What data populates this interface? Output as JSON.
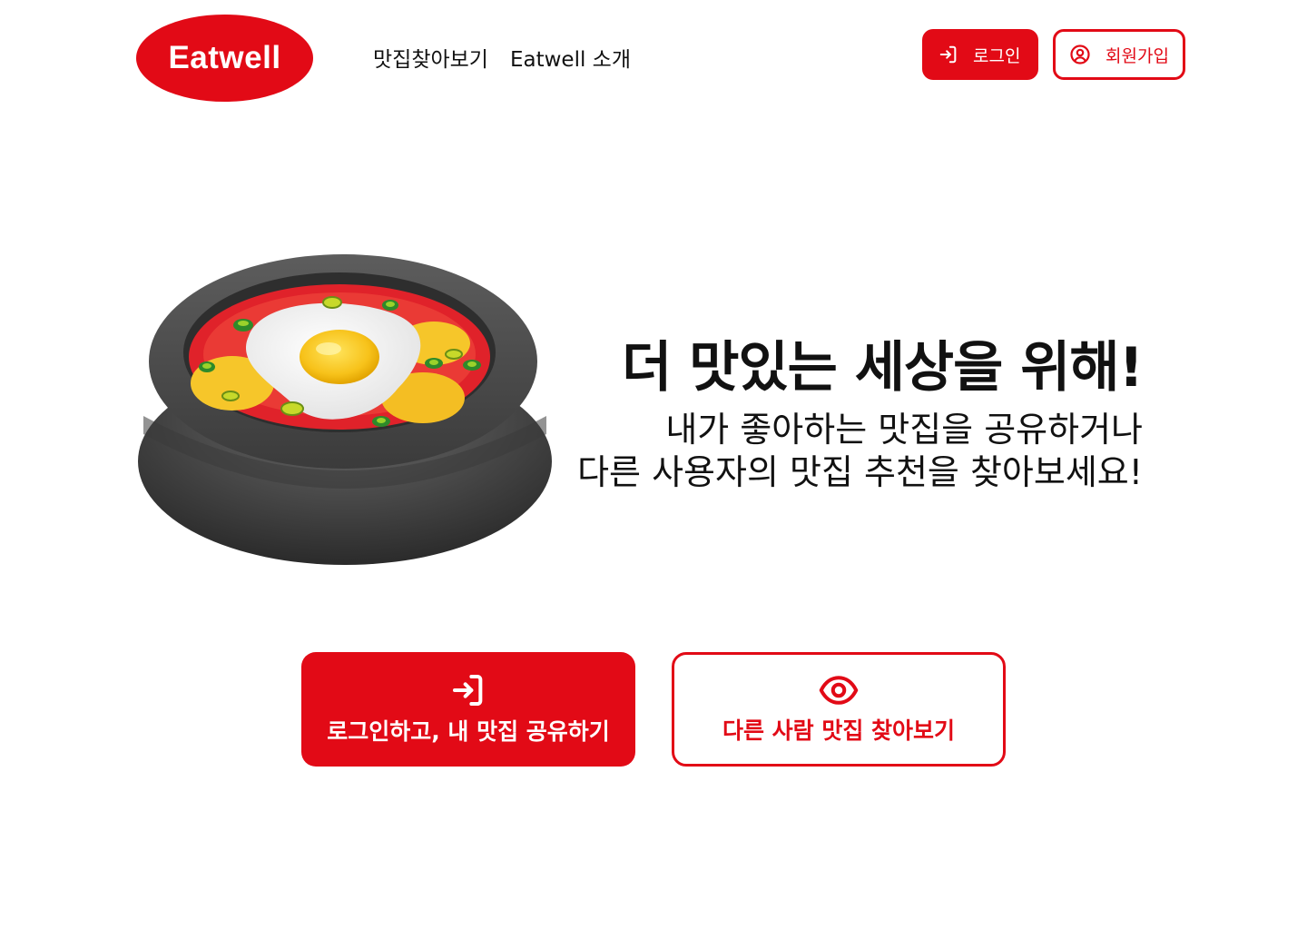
{
  "brand": {
    "name": "Eatwell",
    "accent": "#e20a16"
  },
  "nav": {
    "items": [
      {
        "label": "맛집찾아보기"
      },
      {
        "label": "Eatwell 소개"
      }
    ]
  },
  "header_actions": {
    "login": {
      "label": "로그인",
      "icon": "login-arrow-icon"
    },
    "signup": {
      "label": "회원가입",
      "icon": "user-circle-icon"
    }
  },
  "hero": {
    "title": "더 맛있는 세상을 위해!",
    "subtitle_lines": [
      "내가 좋아하는 맛집을 공유하거나",
      "다른 사용자의 맛집 추천을 찾아보세요!"
    ],
    "image": "egg-stew-bowl-illustration"
  },
  "cta": {
    "primary": {
      "label": "로그인하고, 내 맛집 공유하기",
      "icon": "login-arrow-icon"
    },
    "secondary": {
      "label": "다른 사람 맛집 찾아보기",
      "icon": "eye-icon"
    }
  }
}
